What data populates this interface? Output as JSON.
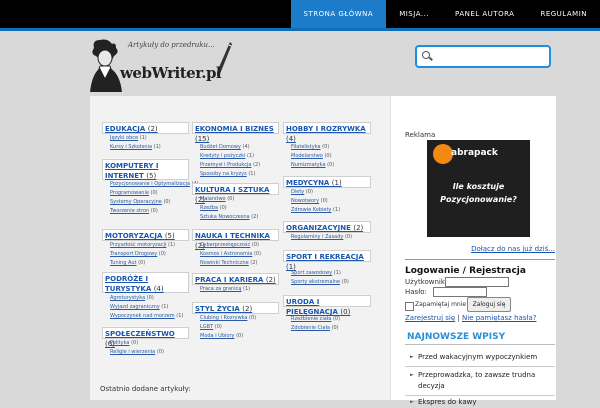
{
  "nav": {
    "items": [
      "STRONA GŁÓWNA",
      "MISJA...",
      "PANEL AUTORA",
      "REGULAMIN"
    ]
  },
  "logo": {
    "tagline": "Artykuły do przedruku...",
    "name": "webWriter.pl"
  },
  "search": {
    "placeholder": ""
  },
  "categories": [
    {
      "name": "EDUKACJA",
      "count": "(2)",
      "subs": [
        {
          "name": "Języki obce",
          "count": "(1)"
        },
        {
          "name": "Kursy i Szkolenia",
          "count": "(1)"
        }
      ]
    },
    {
      "name": "EKONOMIA I BIZNES",
      "count": "(15)",
      "subs": [
        {
          "name": "Budżet Domowy",
          "count": "(4)"
        },
        {
          "name": "Kredyty i pożyczki",
          "count": "(1)"
        },
        {
          "name": "Przemysł i Produkcja",
          "count": "(2)"
        },
        {
          "name": "Sposoby na kryzys",
          "count": "(1)"
        }
      ]
    },
    {
      "name": "HOBBY I ROZRYWKA",
      "count": "(4)",
      "subs": [
        {
          "name": "Filatelistyka",
          "count": "(0)"
        },
        {
          "name": "Modelarstwo",
          "count": "(0)"
        },
        {
          "name": "Numizmatyka",
          "count": "(0)"
        }
      ]
    },
    {
      "name": "KOMPUTERY I INTERNET",
      "count": "(5)",
      "subs": [
        {
          "name": "Pozycjonowanie i Optymalizacja",
          "count": "(4)"
        },
        {
          "name": "Programowanie",
          "count": "(0)"
        },
        {
          "name": "Systemy Operacyjne",
          "count": "(0)"
        },
        {
          "name": "Tworzenie stron",
          "count": "(0)"
        }
      ]
    },
    {
      "name": "KULTURA I SZTUKA",
      "count": "(2)",
      "subs": [
        {
          "name": "Malarstwo",
          "count": "(0)"
        },
        {
          "name": "Rzeźba",
          "count": "(0)"
        },
        {
          "name": "Sztuka Nowoczesna",
          "count": "(2)"
        }
      ]
    },
    {
      "name": "MEDYCYNA",
      "count": "(1)",
      "subs": [
        {
          "name": "Diety",
          "count": "(0)"
        },
        {
          "name": "Nowotwory",
          "count": "(0)"
        },
        {
          "name": "Zdrowie Kobiety",
          "count": "(1)"
        }
      ]
    },
    {
      "name": "ORGANIZACYJNE",
      "count": "(2)",
      "subs": [
        {
          "name": "Regulaminy i Zasady",
          "count": "(0)"
        }
      ]
    },
    {
      "name": "MOTORYZACJA",
      "count": "(5)",
      "subs": [
        {
          "name": "Przyszłość motoryzacji",
          "count": "(1)"
        },
        {
          "name": "Transport Drogowy",
          "count": "(0)"
        },
        {
          "name": "Tuning Aut",
          "count": "(0)"
        }
      ]
    },
    {
      "name": "NAUKA I TECHNIKA",
      "count": "(2)",
      "subs": [
        {
          "name": "Cyberprzestępczość",
          "count": "(0)"
        },
        {
          "name": "Kosmos i Astronomia",
          "count": "(0)"
        },
        {
          "name": "Nowinki Techniczne",
          "count": "(2)"
        }
      ]
    },
    {
      "name": "SPORT I REKREACJA",
      "count": "(1)",
      "subs": [
        {
          "name": "Sport zawodowy",
          "count": "(1)"
        },
        {
          "name": "Sporty ekstremalne",
          "count": "(0)"
        }
      ]
    },
    {
      "name": "PODRÓŻE I TURYSTYKA",
      "count": "(4)",
      "subs": [
        {
          "name": "Agroturystyka",
          "count": "(0)"
        },
        {
          "name": "Wyjazd zagraniczny",
          "count": "(1)"
        },
        {
          "name": "Wypoczynek nad morzem",
          "count": "(1)"
        }
      ]
    },
    {
      "name": "PRACA I KARIERA",
      "count": "(2)",
      "subs": [
        {
          "name": "Praca za granicą",
          "count": "(1)"
        }
      ]
    },
    {
      "name": "URODA I PIELĘGNACJA",
      "count": "(0)",
      "subs": [
        {
          "name": "Rzeźbienie ciała",
          "count": "(0)"
        },
        {
          "name": "Zdobienie Ciała",
          "count": "(0)"
        }
      ]
    },
    {
      "name": "STYL ŻYCIA",
      "count": "(2)",
      "subs": [
        {
          "name": "Clubing i Rozrywka",
          "count": "(0)"
        },
        {
          "name": "LGBT",
          "count": "(0)"
        },
        {
          "name": "Moda i Ubiory",
          "count": "(0)"
        }
      ]
    },
    {
      "name": "SPOŁECZEŃSTWO",
      "count": "(6)",
      "subs": [
        {
          "name": "Polityka",
          "count": "(0)"
        },
        {
          "name": "Religie i wierzenia",
          "count": "(0)"
        }
      ]
    }
  ],
  "main": {
    "last_added": "Ostatnio dodane artykuły:"
  },
  "sidebar": {
    "ad_label": "Reklama",
    "ad_brand": "abrapack",
    "ad_text": "Ile kosztuje Pozycjonowanie?",
    "join_link": "Dołącz do nas już dziś...",
    "login_heading": "Logowanie / Rejestracja",
    "user_label": "Użytkownik:",
    "pass_label": "Hasło:",
    "remember_label": "Zapamiętaj mnie",
    "login_button": "Zaloguj się",
    "register_link": "Zarejestruj się",
    "link_sep": "|",
    "forgot_link": "Nie pamiętasz hasła?",
    "new_posts_heading": "NAJNOWSZE WPISY",
    "posts": [
      "Przed wakacyjnym wypoczynkiem",
      "Przeprowadzka, to zawsze trudna decyzja",
      "Ekspres do kawy"
    ]
  }
}
